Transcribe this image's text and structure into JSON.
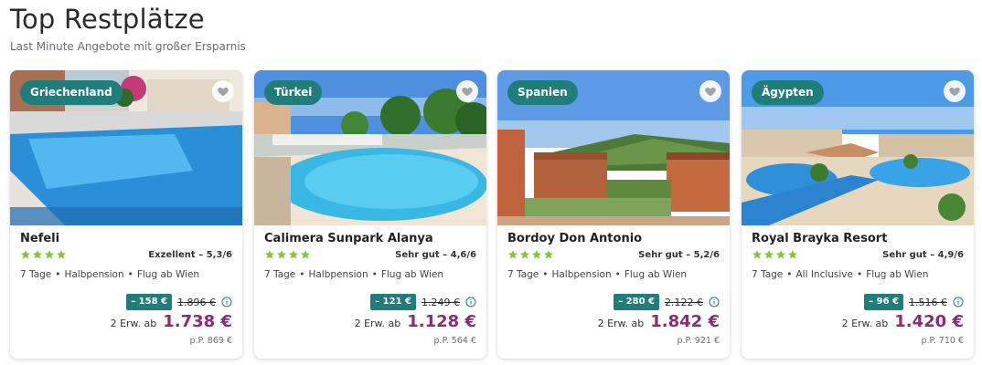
{
  "header": {
    "title": "Top Restplätze",
    "subtitle": "Last Minute Angebote mit großer Ersparnis"
  },
  "colors": {
    "accent": "#1f7e7b",
    "price": "#8a2b73",
    "star": "#8ac43f"
  },
  "cards": [
    {
      "country": "Griechenland",
      "hotel": "Nefeli",
      "stars": 4,
      "rating": "Exzellent – 5,3/6",
      "duration": "7 Tage",
      "board": "Halbpension",
      "flight": "Flug ab Wien",
      "discount": "– 158 €",
      "old_price": "1.896 €",
      "per_label": "2 Erw. ab",
      "price": "1.738 €",
      "pp": "p.P. 869 €"
    },
    {
      "country": "Türkei",
      "hotel": "Calimera Sunpark Alanya",
      "stars": 4,
      "rating": "Sehr gut – 4,6/6",
      "duration": "7 Tage",
      "board": "Halbpension",
      "flight": "Flug ab Wien",
      "discount": "– 121 €",
      "old_price": "1.249 €",
      "per_label": "2 Erw. ab",
      "price": "1.128 €",
      "pp": "p.P. 564 €"
    },
    {
      "country": "Spanien",
      "hotel": "Bordoy Don Antonio",
      "stars": 4,
      "rating": "Sehr gut – 5,2/6",
      "duration": "7 Tage",
      "board": "Halbpension",
      "flight": "Flug ab Wien",
      "discount": "– 280 €",
      "old_price": "2.122 €",
      "per_label": "2 Erw. ab",
      "price": "1.842 €",
      "pp": "p.P. 921 €"
    },
    {
      "country": "Ägypten",
      "hotel": "Royal Brayka Resort",
      "stars": 4,
      "rating": "Sehr gut – 4,9/6",
      "duration": "7 Tage",
      "board": "All Inclusive",
      "flight": "Flug ab Wien",
      "discount": "– 96 €",
      "old_price": "1.516 €",
      "per_label": "2 Erw. ab",
      "price": "1.420 €",
      "pp": "p.P. 710 €"
    }
  ]
}
